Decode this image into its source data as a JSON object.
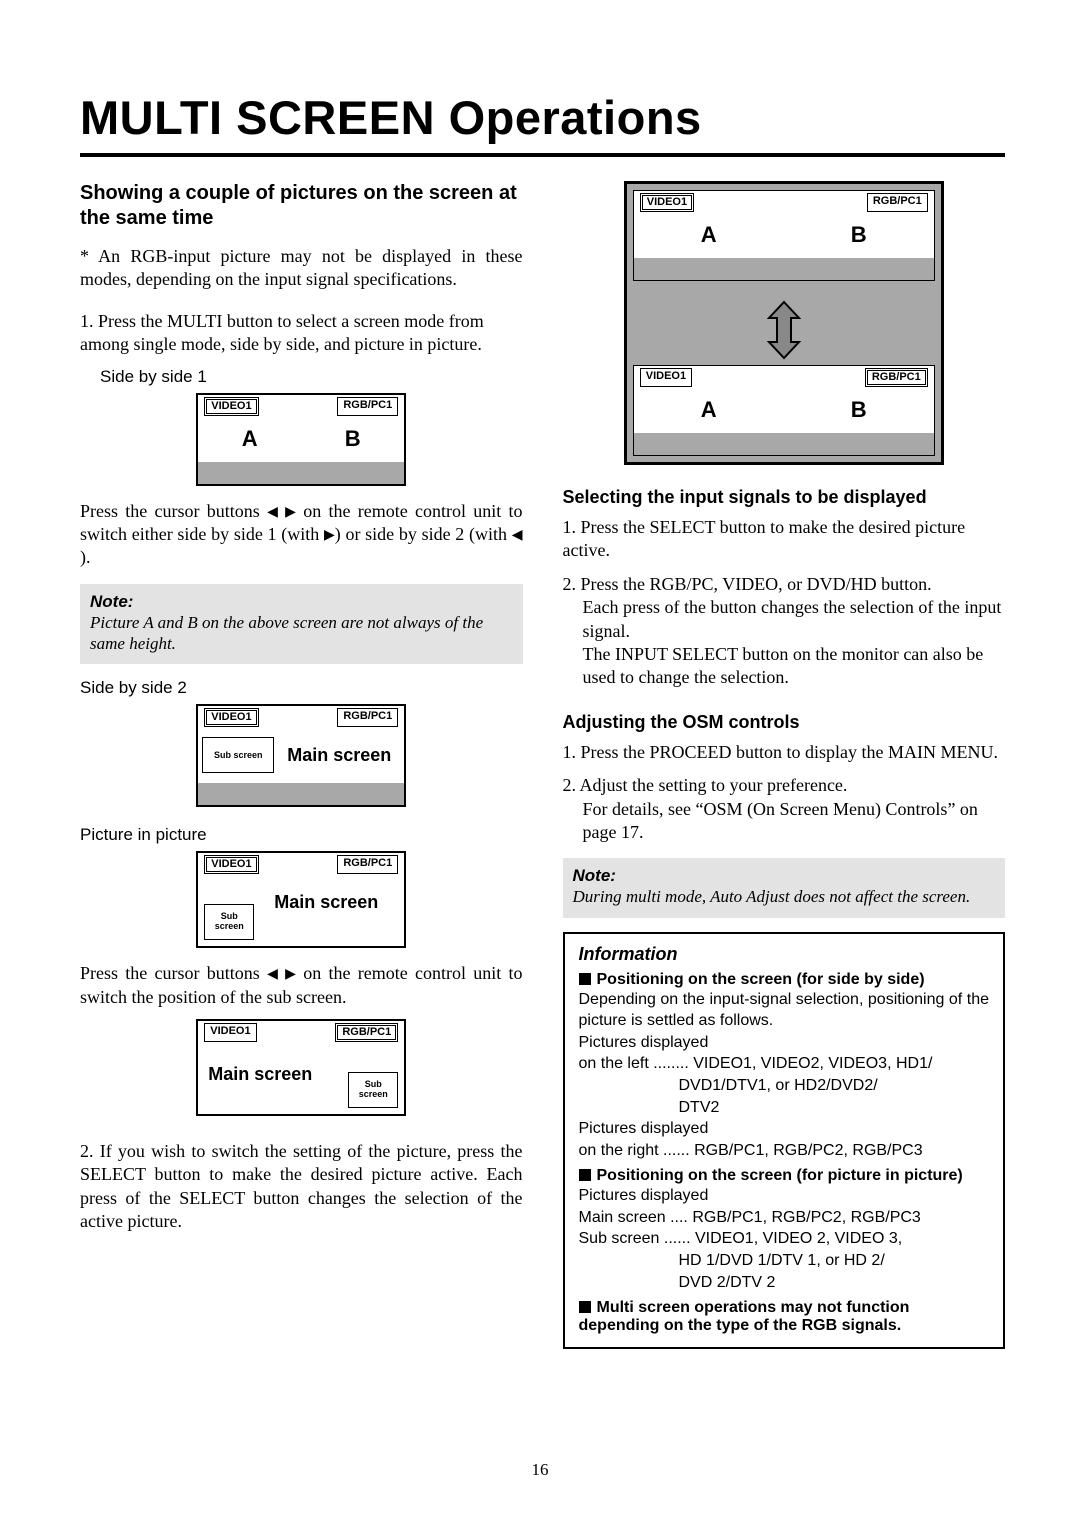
{
  "page_number": "16",
  "title": "MULTI SCREEN Operations",
  "section1_heading": "Showing a couple of pictures on the screen at the same time",
  "footnote": "*  An RGB-input picture may not be displayed in these modes, depending on the input signal specifications.",
  "step1": "1.  Press the MULTI button to select a screen mode from among single mode, side by side, and picture in picture.",
  "sbs1_label": "Side by side 1",
  "input_video1": "VIDEO1",
  "input_rgbpc1": "RGB/PC1",
  "label_A": "A",
  "label_B": "B",
  "sbs1_after_a": "Press the cursor buttons ",
  "sbs1_after_b": " on the remote control unit to switch either side by side 1 (with ",
  "sbs1_after_c": ") or side by side 2 (with ",
  "sbs1_after_d": ").",
  "note_head": "Note:",
  "note1_body": "Picture A and B on the above screen are not always of the same height.",
  "sbs2_label": "Side by side 2",
  "sub_screen": "Sub screen",
  "sub_screen_2line": "Sub\nscreen",
  "main_screen": "Main screen",
  "pip_label": "Picture in picture",
  "pip_after_a": "Press the cursor buttons ",
  "pip_after_b": " on the remote control unit to switch the position of the sub screen.",
  "step2": "2.  If you wish to switch the setting of the picture, press the SELECT button to make the desired picture active. Each press of the SELECT button changes the selection of the active picture.",
  "sel_head": "Selecting the input signals to be displayed",
  "sel_1": "1.  Press the SELECT button to make the desired picture active.",
  "sel_2a": "2.  Press the RGB/PC, VIDEO, or DVD/HD button.",
  "sel_2b": "Each press of the button changes the selection of the input signal.",
  "sel_2c": "The INPUT SELECT button on the monitor can also be used to change the selection.",
  "osm_head": "Adjusting the OSM controls",
  "osm_1": "1.  Press the PROCEED button to display the MAIN MENU.",
  "osm_2a": "2.  Adjust the setting to your preference.",
  "osm_2b": "For details, see “OSM (On Screen Menu) Controls” on page 17.",
  "note2_body": "During multi mode, Auto Adjust does not affect the screen.",
  "info_head": "Information",
  "info_pos_sbs": "Positioning on the screen (for side by side)",
  "info_sbs_1": "Depending on the input-signal selection, positioning of the picture is settled as follows.",
  "info_sbs_2": "Pictures displayed",
  "info_sbs_left": "on the left ........ VIDEO1, VIDEO2, VIDEO3, HD1/",
  "info_sbs_left2": "DVD1/DTV1, or HD2/DVD2/",
  "info_sbs_left3": "DTV2",
  "info_sbs_3": "Pictures displayed",
  "info_sbs_right": "on the right ...... RGB/PC1, RGB/PC2, RGB/PC3",
  "info_pos_pip": "Positioning on the screen (for picture in picture)",
  "info_pip_1": "Pictures displayed",
  "info_pip_main": "Main screen .... RGB/PC1, RGB/PC2, RGB/PC3",
  "info_pip_sub": "Sub screen ...... VIDEO1, VIDEO 2, VIDEO 3,",
  "info_pip_sub2": "HD 1/DVD 1/DTV 1, or HD 2/",
  "info_pip_sub3": "DVD 2/DTV 2",
  "info_warn": "Multi screen operations may not function depending on the type of the RGB signals."
}
